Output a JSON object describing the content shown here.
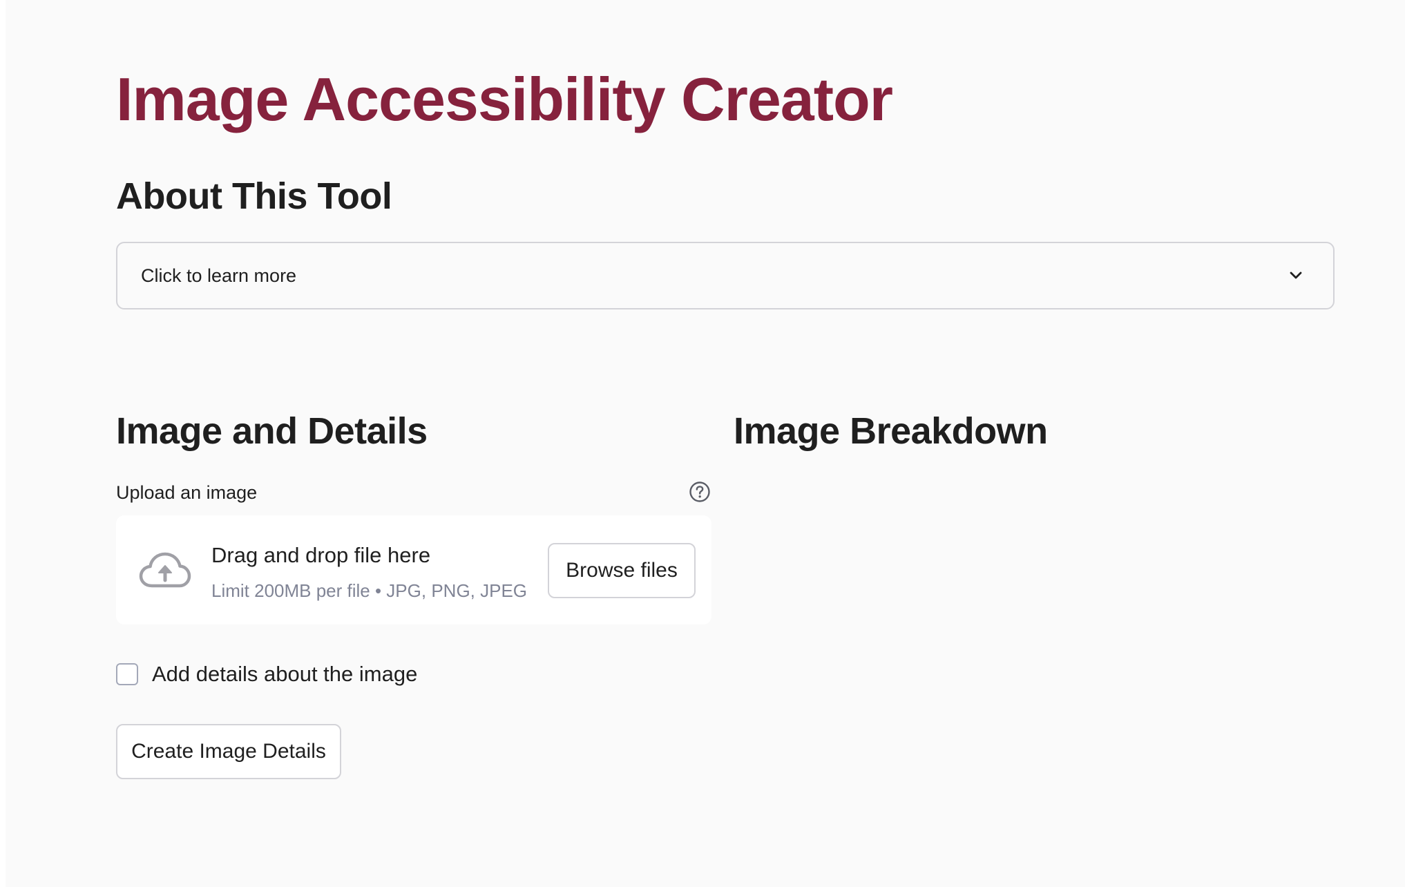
{
  "header": {
    "title": "Image Accessibility Creator"
  },
  "about": {
    "heading": "About This Tool",
    "expander_label": "Click to learn more",
    "expander_icon": "chevron-down-icon"
  },
  "details": {
    "heading": "Image and Details",
    "upload": {
      "label": "Upload an image",
      "help_icon": "question-circle-icon",
      "upload_icon": "cloud-upload-icon",
      "drop_text": "Drag and drop file here",
      "limit_text": "Limit 200MB per file • JPG, PNG, JPEG",
      "browse_label": "Browse files"
    },
    "checkbox": {
      "label": "Add details about the image",
      "checked": false
    },
    "create_button_label": "Create Image Details"
  },
  "breakdown": {
    "heading": "Image Breakdown"
  },
  "colors": {
    "accent": "#86223d",
    "background": "#fafafa",
    "card": "#ffffff",
    "border": "#d3d3d8",
    "muted_text": "#808495"
  }
}
